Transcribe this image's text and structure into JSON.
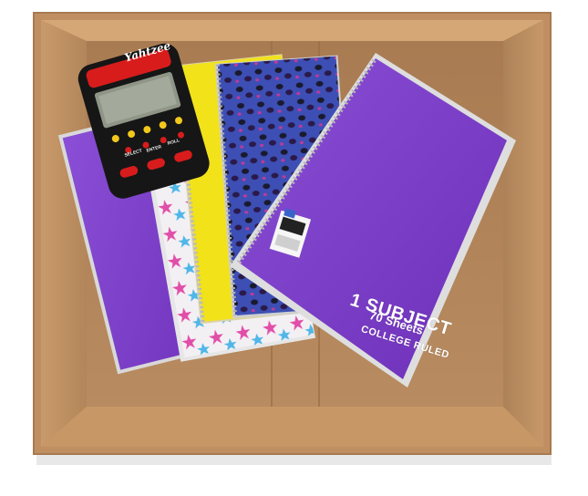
{
  "scene": {
    "colors": {
      "box_interior": "#b98a5f",
      "box_flap": "#c89a6c",
      "notebook_purple": "#7b3fc4",
      "notebook_yellow": "#f2e21a",
      "game_body": "#161616",
      "game_red": "#d81c1c"
    }
  },
  "notebook": {
    "cover_title": "1 SUBJECT",
    "sheet_count": "70 Sheets",
    "ruling": "COLLEGE RULED"
  },
  "handheld_game": {
    "brand": "Yahtzee",
    "button_labels": [
      "SELECT",
      "ENTER",
      "ROLL"
    ]
  }
}
